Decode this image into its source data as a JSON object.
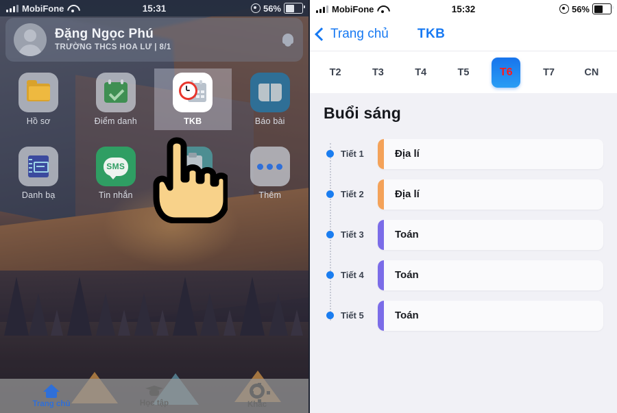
{
  "left": {
    "status": {
      "carrier": "MobiFone",
      "time": "15:31",
      "battery": "56%"
    },
    "user": {
      "name": "Đặng Ngọc Phú",
      "subtitle": "TRƯỜNG THCS HOA LƯ | 8/1"
    },
    "apps": [
      {
        "label": "Hồ sơ",
        "icon": "folder-icon"
      },
      {
        "label": "Điểm danh",
        "icon": "calendar-check-icon"
      },
      {
        "label": "TKB",
        "icon": "clock-calendar-icon"
      },
      {
        "label": "Báo bài",
        "icon": "book-icon"
      },
      {
        "label": "Danh bạ",
        "icon": "notebook-icon"
      },
      {
        "label": "Tin nhắn",
        "icon": "sms-icon"
      },
      {
        "label": "",
        "icon": "clipboard-icon"
      },
      {
        "label": "Thêm",
        "icon": "more-dots-icon"
      }
    ],
    "selected_app": "TKB",
    "sms_text": "SMS",
    "tabbar": [
      {
        "label": "Trang chủ",
        "icon": "home-icon",
        "active": true
      },
      {
        "label": "Học tập",
        "icon": "graduation-cap-icon",
        "active": false
      },
      {
        "label": "Khác",
        "icon": "gear-icon",
        "active": false
      }
    ]
  },
  "right": {
    "status": {
      "carrier": "MobiFone",
      "time": "15:32",
      "battery": "56%"
    },
    "nav": {
      "back_label": "Trang chủ",
      "title": "TKB"
    },
    "days": [
      {
        "label": "T2",
        "active": false
      },
      {
        "label": "T3",
        "active": false
      },
      {
        "label": "T4",
        "active": false
      },
      {
        "label": "T5",
        "active": false
      },
      {
        "label": "T6",
        "active": true
      },
      {
        "label": "T7",
        "active": false
      },
      {
        "label": "CN",
        "active": false
      }
    ],
    "section_title": "Buổi sáng",
    "periods": [
      {
        "period": "Tiết 1",
        "subject": "Địa lí",
        "color": "#f4a259"
      },
      {
        "period": "Tiết 2",
        "subject": "Địa lí",
        "color": "#f4a259"
      },
      {
        "period": "Tiết 3",
        "subject": "Toán",
        "color": "#7b6ce8"
      },
      {
        "period": "Tiết 4",
        "subject": "Toán",
        "color": "#7b6ce8"
      },
      {
        "period": "Tiết 5",
        "subject": "Toán",
        "color": "#7b6ce8"
      }
    ]
  }
}
